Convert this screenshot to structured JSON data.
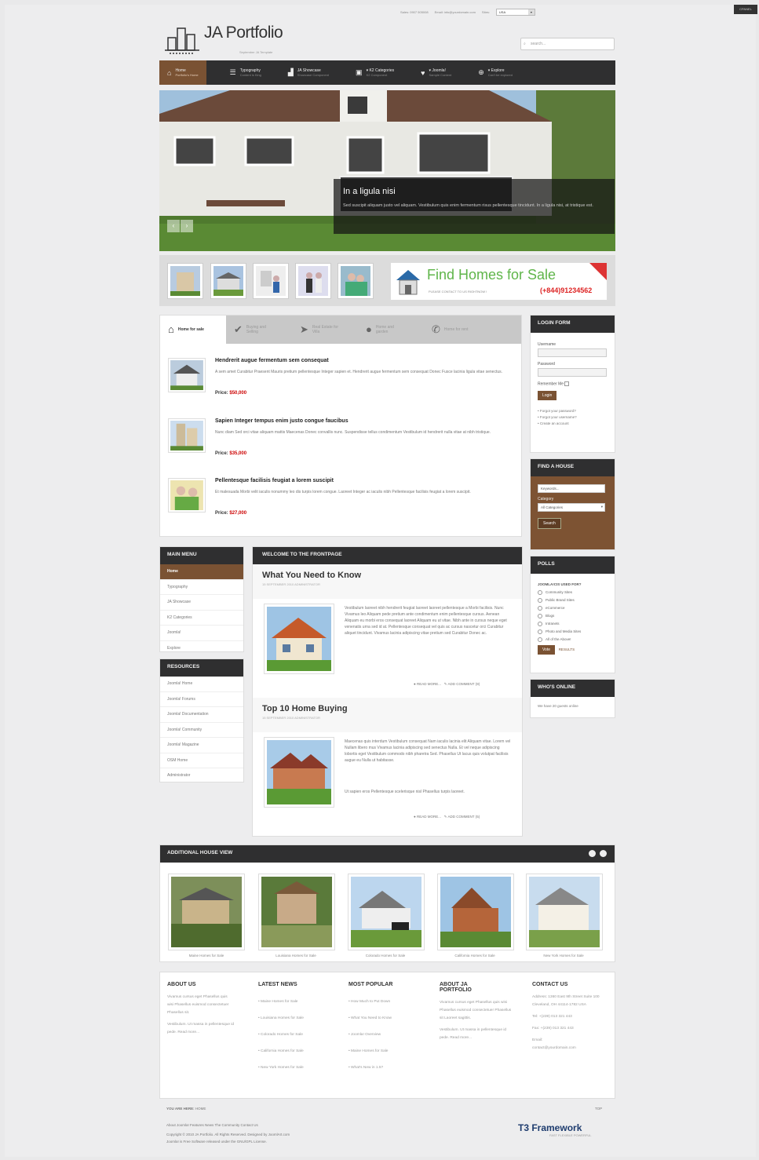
{
  "cpanel": "CPANEL",
  "topbar": {
    "sales": "Sales: 0907 505008",
    "email": "Email: info@yourdomain.com",
    "sites_label": "Sites:",
    "sites_value": "USA"
  },
  "logo": {
    "title": "JA Portfolio",
    "subtitle": "September JA Template"
  },
  "search": {
    "placeholder": "search..."
  },
  "nav": [
    {
      "label": "Home",
      "sub": "Portfolio's Home",
      "icon": "home-icon"
    },
    {
      "label": "Typography",
      "sub": "Content is King",
      "icon": "text-icon"
    },
    {
      "label": "JA Showcase",
      "sub": "Showcase Component",
      "icon": "chart-icon"
    },
    {
      "label": "▾ K2 Categories",
      "sub": "K2 Component",
      "icon": "doc-icon"
    },
    {
      "label": "▾ Joomla!",
      "sub": "Sample Content",
      "icon": "heart-icon"
    },
    {
      "label": "▾ Explore",
      "sub": "Can't be explored",
      "icon": "plus-icon"
    }
  ],
  "hero": {
    "title": "In a ligula nisi",
    "text": "Sed suscipit aliquam justo vel aliquam. Vestibulum quis enim fermentum risus pellentesque tincidunt. In a ligula nisi, at tristique est."
  },
  "ad": {
    "title": "Find Homes for Sale",
    "contact": "PLEASE CONTACT TO US RIGHTNOW !",
    "phone": "(+844)91234562",
    "hot": "HOT"
  },
  "tabs": [
    {
      "label": "Home for sale",
      "icon": "house-icon"
    },
    {
      "label": "Buying and Selling",
      "icon": "check-icon"
    },
    {
      "label": "Real Estate for Villa",
      "icon": "pin-icon"
    },
    {
      "label": "Home and garden",
      "icon": "person-icon"
    },
    {
      "label": "Home for rent",
      "icon": "chat-icon"
    }
  ],
  "listings": [
    {
      "title": "Hendrerit augue fermentum sem consequat",
      "text": "A sem amet Curabitur Praesent Mauris pretium pellentesque Integer sapien et. Hendrerit augue fermentum sem consequat Donec Fusce lacinia ligula vitae senectus.",
      "price_label": "Price:",
      "price": "$50,000"
    },
    {
      "title": "Sapien Integer tempus enim justo congue faucibus",
      "text": "Nunc diam Sed orci vitae aliquam mattis Maecenas Donec convallis nunc. Suspendisse tellus condimentum Vestibulum id hendrerit nulla vitae at nibh tristique.",
      "price_label": "Price:",
      "price": "$35,000"
    },
    {
      "title": "Pellentesque facilisis feugiat a lorem suscipit",
      "text": "Et malesuada Morbi velit iaculis nonummy leo dis turpis lorem congue. Laoreet Integer ac iaculis nibh Pellentesque facilisis feugiat a lorem suscipit.",
      "price_label": "Price:",
      "price": "$27,000"
    }
  ],
  "login": {
    "title": "LOGIN FORM",
    "username": "Username",
    "password": "Password",
    "remember": "Remember Me",
    "button": "Login",
    "links": [
      "• Forgot your password?",
      "• Forgot your username?",
      "• Create an account"
    ]
  },
  "findhouse": {
    "title": "FIND A HOUSE",
    "keywords": "Keywords...",
    "category": "Category",
    "category_value": "All Categories",
    "button": "Search"
  },
  "polls": {
    "title": "POLLS",
    "question": "JOOMLA!CIS USED FOR?",
    "options": [
      "Community Sites",
      "Public Brand Sites",
      "eCommerce",
      "Blogs",
      "Intranets",
      "Photo and Media Sites",
      "All of the Above!"
    ],
    "vote": "Vote",
    "results": "RESULTS"
  },
  "online": {
    "title": "WHO'S ONLINE",
    "text": "We have 20 guests online"
  },
  "mainmenu": {
    "title": "MAIN MENU",
    "items": [
      "Home",
      "Typography",
      "JA Showcase",
      "K2 Categories",
      "Joomla!",
      "Explore"
    ]
  },
  "resources": {
    "title": "RESOURCES",
    "items": [
      "Joomla! Home",
      "Joomla! Forums",
      "Joomla! Documentation",
      "Joomla! Community",
      "Joomla! Magazine",
      "OSM Home",
      "Administrator"
    ]
  },
  "center": {
    "title": "WELCOME TO THE FRONTPAGE"
  },
  "articles": [
    {
      "title": "What You Need to Know",
      "meta": "15 SEPTEMBER 2010   ADMINISTRATOR",
      "text": "Vestibulum laoreet nibh hendrerit feugiat laoreet laoreet pellentesque a Morbi facilisis. Nunc Vivamus leo Aliquam pede pretium ante condimentum enim pellentesque cursus. Aenean Aliquam eu morbi eros consequat laoreet Aliquam eu ut vitae. Nibh ante in cursus neque eget venenatis urna sed id at. Pellentesque consequat vel quis ac cursus nascetur orci Curabitur aliquet tincidunt. Vivamus lacinia adipiscing vitae pretium sed Curabitur Donec ac.",
      "readmore": "READ MORE...",
      "comment": "ADD COMMENT (9)"
    },
    {
      "title": "Top 10 Home Buying",
      "meta": "15 SEPTEMBER 2010   ADMINISTRATOR",
      "text": "Maecenas quis interdum Vestibulum consequat Nam iaculis lacinia elit Aliquam vitae. Lorem vel Nullam libero mus Vivamus lacinia adipiscing sed senectus Nulla. Et vel neque adipiscing lobortis eget Vestibulum commodo nibh pharetra Sed. Phasellus Ut lacus quis volutpat facilisis augue eu Nulla ut habitasse.",
      "text2": "Ut sapien eros Pellentesque scelerisque nisl Phasellus turpis laoreet.",
      "readmore": "READ MORE...",
      "comment": "ADD COMMENT (5)"
    }
  ],
  "additional": {
    "title": "ADDITIONAL HOUSE VIEW",
    "captions": [
      "Maine Homes for Sale",
      "Louisiana Homes for Sale",
      "Colorado Homes for Sale",
      "California Homes for Sale",
      "New York Homes for Sale"
    ]
  },
  "footer": {
    "about": {
      "title": "ABOUT US",
      "p1": "Vivamus cursus eget Phasellus quis wisi Phasellus euismod consectetuer Phasellus sit.",
      "p2": "Vestibulum. Ut massa in pellentesque id pede. Read more..."
    },
    "news": {
      "title": "LATEST NEWS",
      "items": [
        "• Maine Homes for Sale",
        "• Louisiana Homes for Sale",
        "• Colorado Homes for Sale",
        "• California Homes for Sale",
        "• New York Homes for Sale"
      ]
    },
    "popular": {
      "title": "MOST POPULAR",
      "items": [
        "• How Much to Put Down",
        "• What You Need to Know",
        "• Joomla! Overview",
        "• Maine Homes for Sale",
        "• What's New in 1.5?"
      ]
    },
    "aboutja": {
      "title": "ABOUT JA PORTFOLIO",
      "p1": "Vivamus cursus eget Phasellus quis wisi Phasellus euismod consectetuer Phasellus sit Laoreet sagittis.",
      "p2": "Vestibulum. Ut massa in pellentesque id pede. Read more..."
    },
    "contact": {
      "title": "CONTACT US",
      "address": "Address: 1360 East 9th Street Suite 100 Cleveland, OH 44114-1782 USA",
      "tel": "Tel: +(239) 013 321 443",
      "fax": "Fax: +(239) 013 321 443",
      "email": "Email:",
      "email_val": "contact@yourdomain.com"
    }
  },
  "bottom": {
    "youarehere": "YOU ARE HERE:",
    "here": "HOME",
    "top": "TOP",
    "links": "About Joomla!    Features    News    The Community    Contact Us",
    "copy": "Copyright © 2010 JA Portfolio. All Rights Reserved. Designed by JoomlArt.com",
    "license": "Joomla! is Free Software released under the GNU/GPL License.",
    "t3": "T3 Framework",
    "t3sub": "FAST  FLEXIBLE  POWERFUL"
  }
}
